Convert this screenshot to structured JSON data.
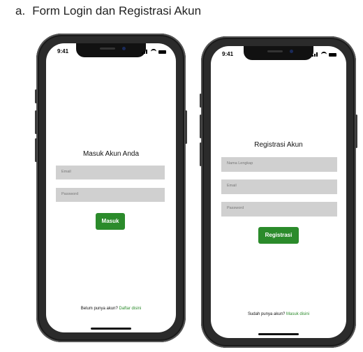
{
  "caption": {
    "marker": "a.",
    "text": "Form Login dan Registrasi Akun"
  },
  "login": {
    "time": "9:41",
    "title": "Masuk  Akun Anda",
    "email_placeholder": "Email",
    "password_placeholder": "Password",
    "submit_label": "Masuk",
    "footer_text": "Belum punya akun?",
    "footer_link": "Daftar disini"
  },
  "register": {
    "time": "9:41",
    "title": "Registrasi Akun",
    "name_placeholder": "Nama Lengkap",
    "email_placeholder": "Email",
    "password_placeholder": "Password",
    "submit_label": "Registrasi",
    "footer_text": "Sudah punya akun?",
    "footer_link": "Masuk disini"
  },
  "colors": {
    "accent": "#2b8b2b",
    "field": "#d0d0d0",
    "frame": "#2b2b2b"
  }
}
